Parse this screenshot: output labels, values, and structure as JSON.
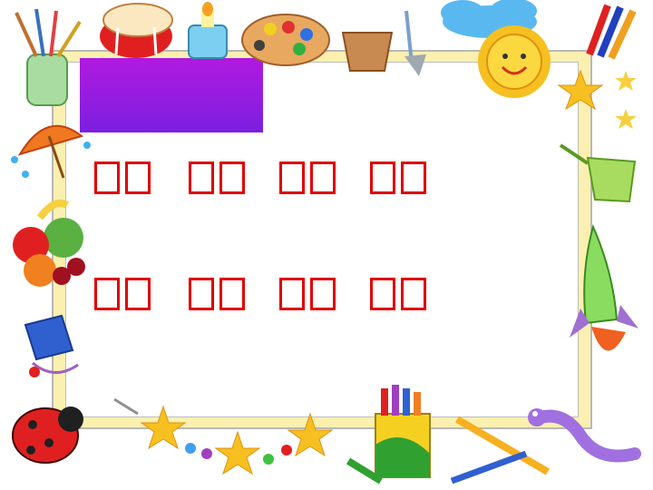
{
  "heading": {
    "label": ""
  },
  "lines": [
    {
      "chars": [
        "□",
        "□",
        "□",
        "□",
        "□",
        "□",
        "□",
        "□"
      ]
    },
    {
      "chars": [
        "□",
        "□",
        "□",
        "□",
        "□",
        "□",
        "□",
        "□"
      ]
    }
  ],
  "colors": {
    "text": "#e00000",
    "title_box_top": "#b11ae0",
    "title_box_bottom": "#7b1fe0",
    "frame": "#fbf0b0"
  },
  "decorations": [
    "paintbrushes-icon",
    "drum-icon",
    "paint-pot-icon",
    "palette-icon",
    "flower-pot-tools-icon",
    "cloud-icon",
    "sun-icon",
    "pencils-icon",
    "star-icon",
    "umbrella-icon",
    "watering-can-icon",
    "fruit-icon",
    "rocket-icon",
    "ink-bottle-icon",
    "ladybug-icon",
    "stars-beads-icon",
    "crayons-icon",
    "pencil-icon",
    "worm-icon"
  ]
}
